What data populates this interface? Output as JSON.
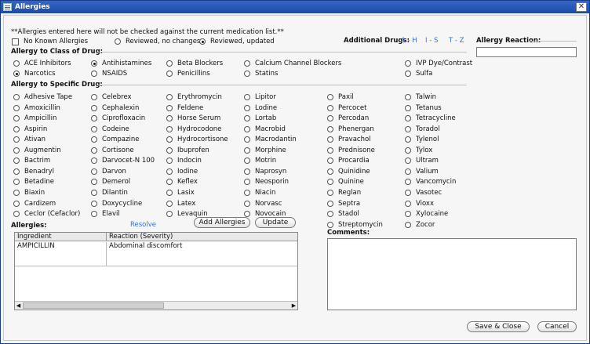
{
  "window": {
    "title": "Allergies",
    "close_glyph": "✕"
  },
  "notice": "**Allergies entered here will not be checked against the current medication list.**",
  "status": {
    "no_known_label": "No Known Allergies",
    "reviewed_no_changes_label": "Reviewed, no changes",
    "reviewed_updated_label": "Reviewed, updated",
    "selected": "reviewed_updated"
  },
  "additional_drugs": {
    "label": "Additional Drugs:",
    "links": [
      "A - H",
      "I - S",
      "T - Z"
    ]
  },
  "allergy_reaction": {
    "label": "Allergy Reaction:",
    "value": ""
  },
  "class_section": {
    "label": "Allergy to Class of Drug:",
    "items": [
      {
        "label": "ACE Inhibitors",
        "checked": false
      },
      {
        "label": "Antihistamines",
        "checked": true
      },
      {
        "label": "Beta Blockers",
        "checked": false
      },
      {
        "label": "Calcium Channel Blockers",
        "checked": false
      },
      {
        "label": "IVP Dye/Contrast",
        "checked": false
      },
      {
        "label": "Narcotics",
        "checked": true
      },
      {
        "label": "NSAIDS",
        "checked": false
      },
      {
        "label": "Penicillins",
        "checked": false
      },
      {
        "label": "Statins",
        "checked": false
      },
      {
        "label": "Sulfa",
        "checked": false
      }
    ]
  },
  "specific_section": {
    "label": "Allergy to Specific Drug:",
    "columns": [
      [
        "Adhesive Tape",
        "Amoxicillin",
        "Ampicillin",
        "Aspirin",
        "Ativan",
        "Augmentin",
        "Bactrim",
        "Benadryl",
        "Betadine",
        "Biaxin",
        "Cardizem",
        "Ceclor (Cefaclor)"
      ],
      [
        "Celebrex",
        "Cephalexin",
        "Ciprofloxacin",
        "Codeine",
        "Compazine",
        "Cortisone",
        "Darvocet-N 100",
        "Darvon",
        "Demerol",
        "Dilantin",
        "Doxycycline",
        "Elavil"
      ],
      [
        "Erythromycin",
        "Feldene",
        "Horse Serum",
        "Hydrocodone",
        "Hydrocortisone",
        "Ibuprofen",
        "Indocin",
        "Iodine",
        "Keflex",
        "Lasix",
        "Latex",
        "Levaquin"
      ],
      [
        "Lipitor",
        "Lodine",
        "Lortab",
        "Macrobid",
        "Macrodantin",
        "Morphine",
        "Motrin",
        "Naprosyn",
        "Neosporin",
        "Niacin",
        "Norvasc",
        "Novocain"
      ],
      [
        "Paxil",
        "Percocet",
        "Percodan",
        "Phenergan",
        "Pravachol",
        "Prednisone",
        "Procardia",
        "Quinidine",
        "Quinine",
        "Reglan",
        "Septra",
        "Stadol",
        "Streptomycin"
      ],
      [
        "Talwin",
        "Tetanus",
        "Tetracycline",
        "Toradol",
        "Tylenol",
        "Tylox",
        "Ultram",
        "Valium",
        "Vancomycin",
        "Vasotec",
        "Vioxx",
        "Xylocaine",
        "Zocor"
      ]
    ]
  },
  "allergies": {
    "label": "Allergies:",
    "resolve_label": "Resolve",
    "add_button": "Add Allergies",
    "update_button": "Update",
    "columns": [
      "Ingredient",
      "Reaction (Severity)"
    ],
    "rows": [
      {
        "ingredient": "AMPICILLIN",
        "reaction": "Abdominal discomfort"
      }
    ]
  },
  "comments": {
    "label": "Comments:",
    "value": ""
  },
  "footer": {
    "save_button": "Save & Close",
    "cancel_button": "Cancel"
  }
}
